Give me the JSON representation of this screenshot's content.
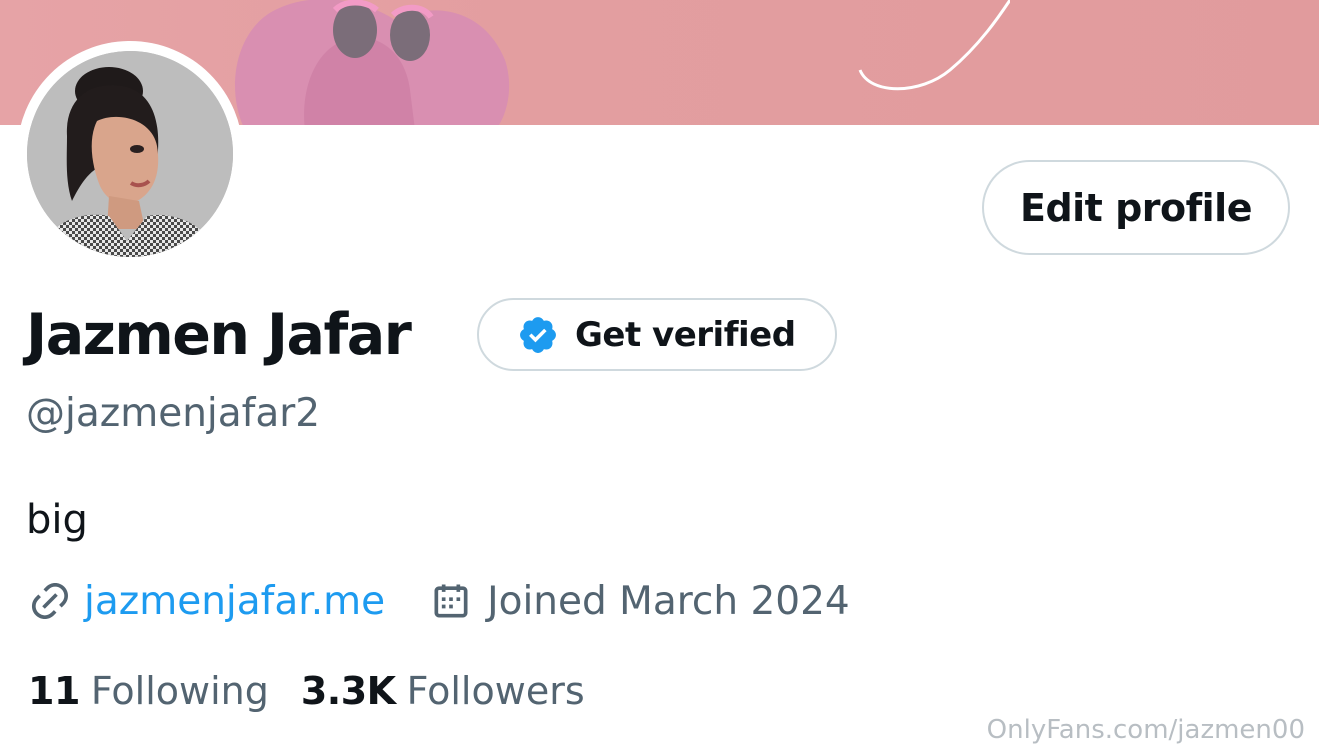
{
  "profile": {
    "display_name": "Jazmen Jafar",
    "handle": "@jazmenjafar2",
    "bio": "big",
    "website": "jazmenjafar.me",
    "joined": "Joined March 2024",
    "following_count": "11",
    "following_label": "Following",
    "followers_count": "3.3K",
    "followers_label": "Followers"
  },
  "actions": {
    "edit_profile_label": "Edit profile",
    "get_verified_label": "Get verified"
  },
  "icons": {
    "verified": "verified-badge-icon",
    "link": "link-icon",
    "calendar": "calendar-icon"
  },
  "colors": {
    "banner": "#e39ea0",
    "accent": "#1d9bf0",
    "secondary_text": "#536471",
    "primary_text": "#0f1419",
    "border": "#cfd9de"
  },
  "watermark": "OnlyFans.com/jazmen00"
}
